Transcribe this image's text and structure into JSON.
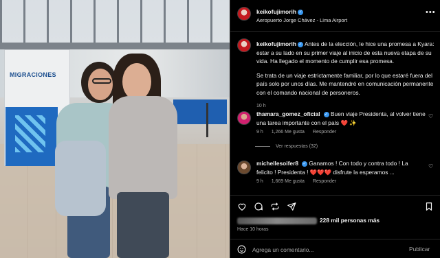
{
  "post": {
    "username": "keikofujimorih",
    "location": "Aeropuerto Jorge Chávez - Lima Airport",
    "more_icon": "more-horizontal-icon",
    "photo_sign": "MIGRACIONES"
  },
  "caption": {
    "username": "keikofujimorih",
    "paragraph1": "Antes de la elección, le hice una promesa a Kyara: estar a su lado en su primer viaje al inicio de esta nueva etapa de su vida. Ha llegado el momento de cumplir esa promesa.",
    "paragraph2": "Se trata de un viaje estrictamente familiar, por lo que estaré fuera del país solo por unos días. Me mantendré en comunicación permanente con el comando nacional de personeros.",
    "time": "10 h"
  },
  "comments": [
    {
      "username": "thamara_gomez_oficial",
      "text": "Buen viaje Presidenta, al volver tiene una tarea importante con el país ❤️ ✨",
      "time": "9 h",
      "likes": "1,266 Me gusta",
      "reply": "Responder",
      "view_replies": "Ver respuestas (32)"
    },
    {
      "username": "michellesoifer8",
      "text": "Ganamos ! Con todo y contra todo ! La felicito ! Presidenta ! ❤️❤️❤️ disfrute la esperamos ...",
      "time": "9 h",
      "likes": "1,669 Me gusta",
      "reply": "Responder"
    }
  ],
  "footer": {
    "likes_text": "228 mil personas más",
    "time_ago": "Hace 10 horas",
    "comment_placeholder": "Agrega un comentario...",
    "publish_label": "Publicar"
  },
  "colors": {
    "background": "#000000",
    "text": "#f5f5f5",
    "secondary": "#a8a8a8",
    "verified": "#3897f0",
    "divider": "#262626"
  }
}
